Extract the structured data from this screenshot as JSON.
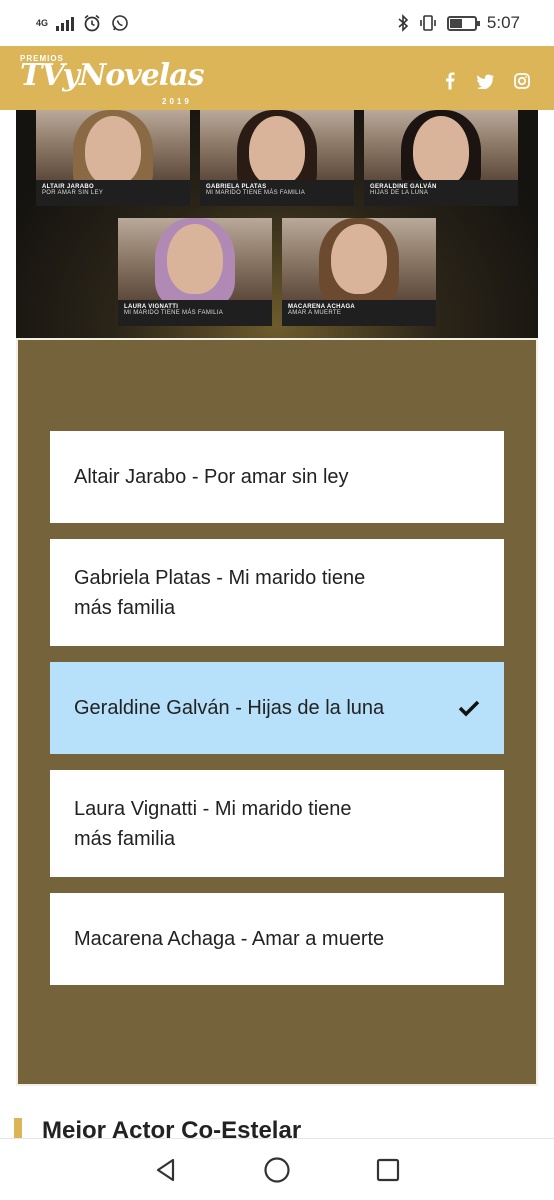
{
  "status_bar": {
    "network": "4G",
    "time": "5:07",
    "battery_level": 0.5,
    "icons": [
      "signal-icon",
      "alarm-icon",
      "whatsapp-icon",
      "bluetooth-icon",
      "vibrate-icon",
      "battery-icon"
    ]
  },
  "header": {
    "logo_premios": "PREMIOS",
    "logo_main": "TVyNovelas",
    "logo_year": "2019",
    "social": [
      "facebook-icon",
      "twitter-icon",
      "instagram-icon"
    ]
  },
  "nominee_photos": [
    {
      "name": "ALTAIR JARABO",
      "show": "POR AMAR SIN LEY",
      "hair": "#8a6a45"
    },
    {
      "name": "GABRIELA PLATAS",
      "show": "MI MARIDO TIENE MÁS FAMILIA",
      "hair": "#2a1c14"
    },
    {
      "name": "GERALDINE GALVÁN",
      "show": "HIJAS DE LA LUNA",
      "hair": "#1c1410"
    },
    {
      "name": "LAURA VIGNATTI",
      "show": "MI MARIDO TIENE MÁS FAMILIA",
      "hair": "#b08ab4"
    },
    {
      "name": "MACARENA ACHAGA",
      "show": "AMAR A MUERTE",
      "hair": "#6b4a30"
    }
  ],
  "options": [
    {
      "line1": "Altair Jarabo - Por amar sin ley",
      "line2": "",
      "selected": false
    },
    {
      "line1": "Gabriela Platas - Mi marido tiene",
      "line2": "más familia",
      "selected": false
    },
    {
      "line1": "Geraldine Galván - Hijas de la luna",
      "line2": "",
      "selected": true
    },
    {
      "line1": "Laura Vignatti - Mi marido tiene",
      "line2": "más familia",
      "selected": false
    },
    {
      "line1": "Macarena Achaga - Amar a muerte",
      "line2": "",
      "selected": false
    }
  ],
  "next_section_title": "Mejor Actor Co-Estelar",
  "colors": {
    "brand_gold": "#dbb558",
    "panel_olive": "#75643b",
    "selected_blue": "#b7e0fb"
  },
  "nav": [
    "back-icon",
    "home-icon",
    "recents-icon"
  ]
}
